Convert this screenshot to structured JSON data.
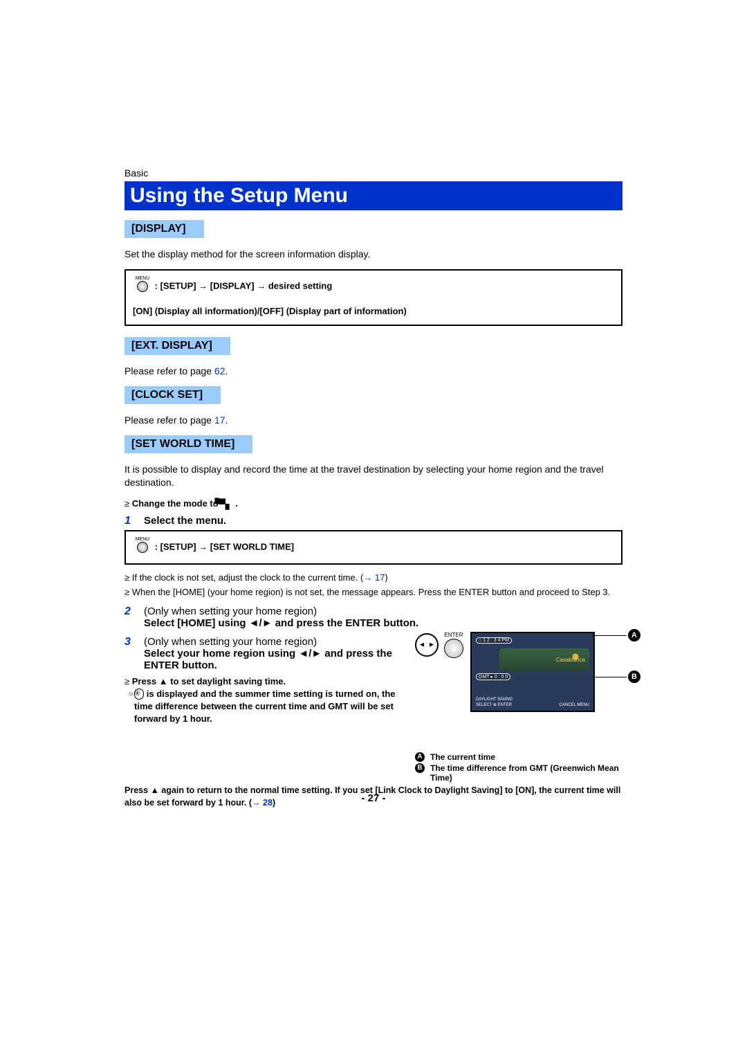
{
  "category": "Basic",
  "title": "Using the Setup Menu",
  "sections": {
    "display": {
      "label": "[DISPLAY]",
      "desc": "Set the display method for the screen information display.",
      "menu_label": "MENU",
      "path": ": [SETUP] → [DISPLAY] → desired setting",
      "options": "[ON] (Display all information)/[OFF] (Display part of information)"
    },
    "ext_display": {
      "label": "[EXT. DISPLAY]",
      "ref_prefix": "Please refer to page ",
      "ref_page": "62",
      "ref_suffix": "."
    },
    "clock_set": {
      "label": "[CLOCK SET]",
      "ref_prefix": "Please refer to page ",
      "ref_page": "17",
      "ref_suffix": "."
    },
    "world_time": {
      "label": "[SET WORLD TIME]",
      "desc": "It is possible to display and record the time at the travel destination by selecting your home region and the travel destination.",
      "change_mode_prefix": "Change the mode to ",
      "change_mode_suffix": " .",
      "step1_num": "1",
      "step1_text": "Select the menu.",
      "menu_label": "MENU",
      "menu_path": ": [SETUP] → [SET WORLD TIME]",
      "note1_a": "If the clock is not set, adjust the clock to the current time. (",
      "note1_link": "→ 17",
      "note1_b": ")",
      "note2": "When the [HOME] (your home region) is not set, the message appears. Press the ENTER button and proceed to Step 3.",
      "step2_num": "2",
      "step2_pre": "(Only when setting your home region)",
      "step2_bold": "Select [HOME] using ◄/► and press the ENTER button.",
      "step3_num": "3",
      "step3_pre": "(Only when setting your home region)",
      "step3_bold": "Select your home region using ◄/► and press the ENTER button.",
      "sub_note_line1": "Press ▲ to set daylight saving time.",
      "sub_note_icon_text": "☼④",
      "sub_note_line2a": " is displayed and the summer time setting is turned on, the time difference between the current time and GMT will be set forward by 1 hour.",
      "sub_note_line3": "Press ▲ again to return to the normal time setting. If you set [Link Clock to Daylight Saving] to [ON], the current time will also be set forward by 1 hour. (",
      "sub_note_link": "→ 28",
      "sub_note_end": ")",
      "screen": {
        "time": "⌂ 1 2 : 3 4 PM",
        "gmt": "GMT  ▸  0 : 0 0",
        "city": "Casablanca",
        "bl_left1": "DAYLIGHT SAVING",
        "bl_left2": "SELECT ⊕ ENTER",
        "bl_right": "CANCEL  MENU"
      },
      "enter_label": "ENTER",
      "legend_a": "The current time",
      "legend_b": "The time difference from GMT (Greenwich Mean Time)"
    }
  },
  "page_number": "- 27 -"
}
